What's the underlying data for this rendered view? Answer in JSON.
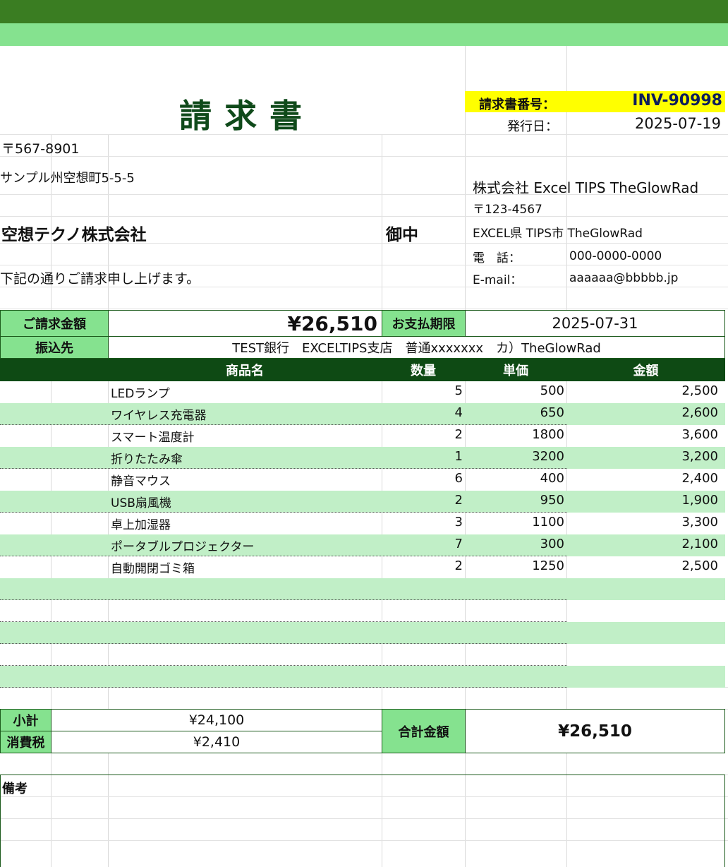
{
  "colors": {
    "dark_green": "#3a7d22",
    "light_green": "#85e28f",
    "header_green": "#0e4a14",
    "row_green": "#c1efc7",
    "highlight_yellow": "#ffff00"
  },
  "title": "請求書",
  "invoice_no": {
    "label": "請求書番号：",
    "value": "INV-90998"
  },
  "issue_date": {
    "label": "発行日：",
    "value": "2025-07-19"
  },
  "customer": {
    "zip": "〒567-8901",
    "address": "サンプル州空想町5-5-5",
    "name": "空想テクノ株式会社",
    "honorific": "御中",
    "message": "下記の通りご請求申し上げます。"
  },
  "issuer": {
    "company": "株式会社 Excel TIPS TheGlowRad",
    "zip": "〒123-4567",
    "address": "EXCEL県 TIPS市 TheGlowRad",
    "tel_label": "電　話：",
    "tel": "000-0000-0000",
    "email_label": "E-mail：",
    "email": "aaaaaa@bbbbb.jp"
  },
  "billing": {
    "amount_label": "ご請求金額",
    "amount": "¥26,510",
    "due_label": "お支払期限",
    "due": "2025-07-31",
    "bank_label": "振込先",
    "bank": "TEST銀行　EXCELTIPS支店　普通xxxxxxx　カ）TheGlowRad"
  },
  "table": {
    "headers": [
      "商品名",
      "数量",
      "単価",
      "金額"
    ],
    "rows": [
      {
        "name": "LEDランプ",
        "qty": "5",
        "price": "500",
        "amount": "2,500"
      },
      {
        "name": "ワイヤレス充電器",
        "qty": "4",
        "price": "650",
        "amount": "2,600"
      },
      {
        "name": "スマート温度計",
        "qty": "2",
        "price": "1800",
        "amount": "3,600"
      },
      {
        "name": "折りたたみ傘",
        "qty": "1",
        "price": "3200",
        "amount": "3,200"
      },
      {
        "name": "静音マウス",
        "qty": "6",
        "price": "400",
        "amount": "2,400"
      },
      {
        "name": "USB扇風機",
        "qty": "2",
        "price": "950",
        "amount": "1,900"
      },
      {
        "name": "卓上加湿器",
        "qty": "3",
        "price": "1100",
        "amount": "3,300"
      },
      {
        "name": "ポータブルプロジェクター",
        "qty": "7",
        "price": "300",
        "amount": "2,100"
      },
      {
        "name": "自動開閉ゴミ箱",
        "qty": "2",
        "price": "1250",
        "amount": "2,500"
      },
      {
        "name": "",
        "qty": "",
        "price": "",
        "amount": ""
      },
      {
        "name": "",
        "qty": "",
        "price": "",
        "amount": ""
      },
      {
        "name": "",
        "qty": "",
        "price": "",
        "amount": ""
      },
      {
        "name": "",
        "qty": "",
        "price": "",
        "amount": ""
      },
      {
        "name": "",
        "qty": "",
        "price": "",
        "amount": ""
      }
    ]
  },
  "totals": {
    "subtotal_label": "小計",
    "subtotal": "¥24,100",
    "tax_label": "消費税",
    "tax": "¥2,410",
    "total_label": "合計金額",
    "total": "¥26,510"
  },
  "remarks": {
    "label": "備考"
  }
}
